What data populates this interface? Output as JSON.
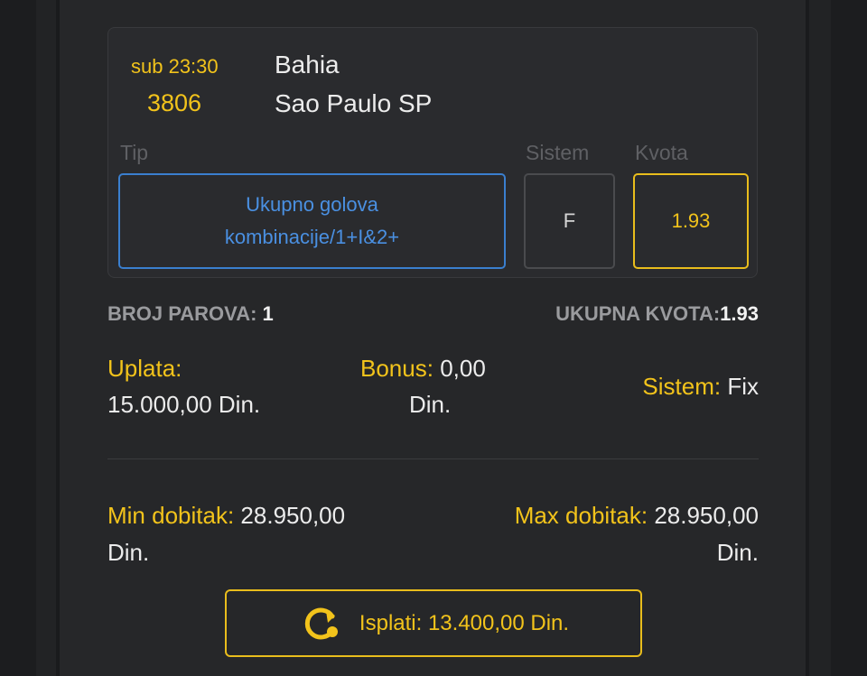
{
  "match": {
    "time": "sub 23:30",
    "code": "3806",
    "home_team": "Bahia",
    "away_team": "Sao Paulo SP"
  },
  "columns": {
    "tip_label": "Tip",
    "system_label": "Sistem",
    "odds_label": "Kvota"
  },
  "selection": {
    "tip_line1": "Ukupno golova",
    "tip_line2": "kombinacije/1+I&2+",
    "system_value": "F",
    "odds_value": "1.93"
  },
  "summary": {
    "pairs_label": "BROJ PAROVA:",
    "pairs_value": "1",
    "total_odds_label": "UKUPNA KVOTA:",
    "total_odds_value": "1.93"
  },
  "stake": {
    "payment_label": "Uplata:",
    "payment_value": "15.000,00 Din.",
    "bonus_label": "Bonus:",
    "bonus_value_line1": "0,00",
    "bonus_value_line2": "Din.",
    "system_label": "Sistem:",
    "system_value": "Fix"
  },
  "winnings": {
    "min_label": "Min dobitak:",
    "min_value_line1": "28.950,00",
    "min_value_line2": "Din.",
    "max_label": "Max dobitak:",
    "max_value_line1": "28.950,00",
    "max_value_line2": "Din."
  },
  "cashout": {
    "icon": "cashout-refresh-icon",
    "label": "Isplati: 13.400,00 Din."
  },
  "colors": {
    "accent_yellow": "#f2c31b",
    "tip_blue": "#4a90e2",
    "background": "#262729"
  }
}
